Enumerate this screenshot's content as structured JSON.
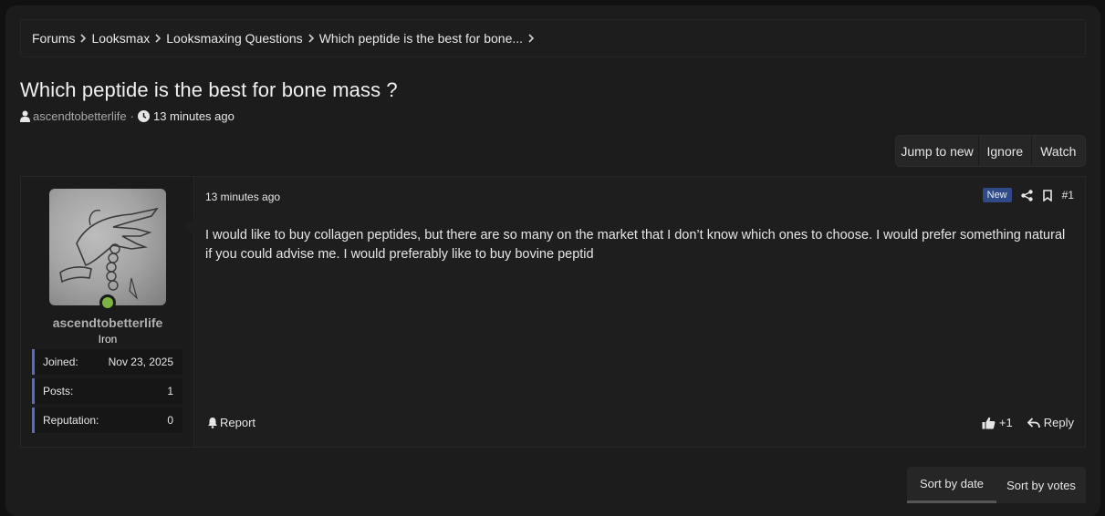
{
  "breadcrumb": [
    {
      "label": "Forums"
    },
    {
      "label": "Looksmax"
    },
    {
      "label": "Looksmaxing Questions"
    },
    {
      "label": "Which peptide is the best for bone..."
    }
  ],
  "thread": {
    "title": "Which peptide is the best for bone mass ?",
    "author": "ascendtobetterlife",
    "separator": "·",
    "time": "13 minutes ago"
  },
  "thread_buttons": {
    "jump": "Jump to new",
    "ignore": "Ignore",
    "watch": "Watch"
  },
  "post": {
    "time": "13 minutes ago",
    "badge": "New",
    "number": "#1",
    "body": "I would like to buy collagen peptides, but there are so many on the market that I don’t know which ones to choose. I would prefer something natural if you could advise me. I would preferably like to buy bovine peptid",
    "report": "Report",
    "likes": "+1",
    "reply": "Reply"
  },
  "user": {
    "name": "ascendtobetterlife",
    "rank": "Iron",
    "stats": [
      {
        "label": "Joined:",
        "value": "Nov 23, 2025"
      },
      {
        "label": "Posts:",
        "value": "1"
      },
      {
        "label": "Reputation:",
        "value": "0"
      }
    ],
    "online_color": "#7cb342"
  },
  "sort": {
    "date": "Sort by date",
    "votes": "Sort by votes"
  },
  "colors": {
    "background": "#1c1c1c",
    "accent": "#5c6bc0",
    "new_badge": "#2f4a86"
  }
}
